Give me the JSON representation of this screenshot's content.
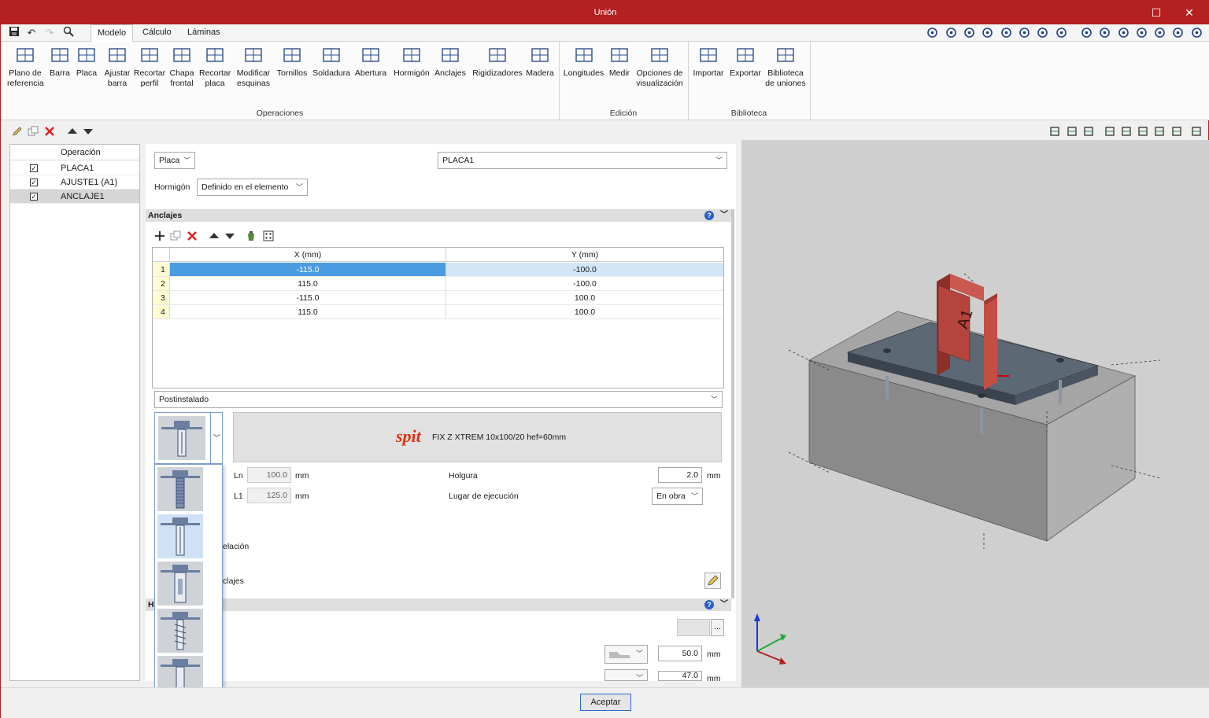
{
  "window": {
    "title": "Unión",
    "minimize_glyph": "☐",
    "close_glyph": "✕"
  },
  "menu": {
    "tabs": [
      "Modelo",
      "Cálculo",
      "Láminas"
    ],
    "active_tab": "Modelo"
  },
  "ribbon": {
    "operaciones": [
      {
        "line1": "Plano de",
        "line2": "referencia",
        "icon": "grid-icon"
      },
      {
        "line1": "Barra",
        "line2": "",
        "icon": "beam-icon"
      },
      {
        "line1": "Placa",
        "line2": "",
        "icon": "plate-icon"
      },
      {
        "line1": "Ajustar",
        "line2": "barra",
        "icon": "fit-bar-icon"
      },
      {
        "line1": "Recortar",
        "line2": "perfil",
        "icon": "cut-profile-icon"
      },
      {
        "line1": "Chapa",
        "line2": "frontal",
        "icon": "front-plate-icon"
      },
      {
        "line1": "Recortar",
        "line2": "placa",
        "icon": "cut-plate-icon"
      },
      {
        "line1": "Modificar",
        "line2": "esquinas",
        "icon": "corners-icon"
      },
      {
        "line1": "Tornillos",
        "line2": "",
        "icon": "bolt-icon"
      },
      {
        "line1": "Soldadura",
        "line2": "",
        "icon": "weld-icon"
      },
      {
        "line1": "Abertura",
        "line2": "",
        "icon": "opening-icon"
      },
      {
        "line1": "Hormigón",
        "line2": "",
        "icon": "concrete-icon"
      },
      {
        "line1": "Anclajes",
        "line2": "",
        "icon": "anchor-icon"
      },
      {
        "line1": "Rigidizadores",
        "line2": "",
        "icon": "stiffener-icon"
      },
      {
        "line1": "Madera",
        "line2": "",
        "icon": "wood-icon"
      }
    ],
    "edicion": [
      {
        "line1": "Longitudes",
        "line2": "",
        "icon": "lengths-icon"
      },
      {
        "line1": "Medir",
        "line2": "",
        "icon": "ruler-icon"
      },
      {
        "line1": "Opciones de",
        "line2": "visualización",
        "icon": "view-options-icon"
      }
    ],
    "biblioteca": [
      {
        "line1": "Importar",
        "line2": "",
        "icon": "import-icon"
      },
      {
        "line1": "Exportar",
        "line2": "",
        "icon": "export-icon"
      },
      {
        "line1": "Biblioteca",
        "line2": "de uniones",
        "icon": "library-icon"
      }
    ],
    "groups": {
      "operaciones": "Operaciones",
      "edicion": "Edición",
      "biblioteca": "Biblioteca"
    }
  },
  "operations": {
    "header": "Operación",
    "rows": [
      {
        "label": "PLACA1",
        "checked": true
      },
      {
        "label": "AJUSTE1 (A1)",
        "checked": true
      },
      {
        "label": "ANCLAJE1",
        "checked": true
      }
    ]
  },
  "form": {
    "type_select": "Placa",
    "element_select": "PLACA1",
    "hormigon_label": "Hormigón",
    "hormigon_select": "Definido en el elemento"
  },
  "anclajes": {
    "title": "Anclajes",
    "columns": [
      "X (mm)",
      "Y (mm)"
    ],
    "rows": [
      {
        "n": "1",
        "x": "-115.0",
        "y": "-100.0"
      },
      {
        "n": "2",
        "x": "115.0",
        "y": "-100.0"
      },
      {
        "n": "3",
        "x": "-115.0",
        "y": "100.0"
      },
      {
        "n": "4",
        "x": "115.0",
        "y": "100.0"
      }
    ],
    "install_type": "Postinstalado",
    "product_brand": "spit",
    "product_name": "FIX Z XTREM 10x100/20 hef=60mm",
    "ln_label": "Ln",
    "ln_value": "100.0",
    "ln_unit": "mm",
    "l1_label": "L1",
    "l1_value": "125.0",
    "l1_unit": "mm",
    "holgura_label": "Holgura",
    "holgura_value": "2.0",
    "holgura_unit": "mm",
    "lugar_label": "Lugar de ejecución",
    "lugar_value": "En obra",
    "partial_label_1": "elación",
    "partial_label_2": "clajes"
  },
  "section2": {
    "title_partial": "H",
    "value1": "50.0",
    "unit1": "mm",
    "value2": "47.0",
    "unit2": "mm",
    "ellipsis": "..."
  },
  "viewport": {
    "member_label": "A1"
  },
  "footer": {
    "accept": "Aceptar"
  },
  "colors": {
    "title_bar": "#b52020",
    "selection": "#4a9be0",
    "steel": "#b4443c",
    "plate": "#5d6875"
  }
}
